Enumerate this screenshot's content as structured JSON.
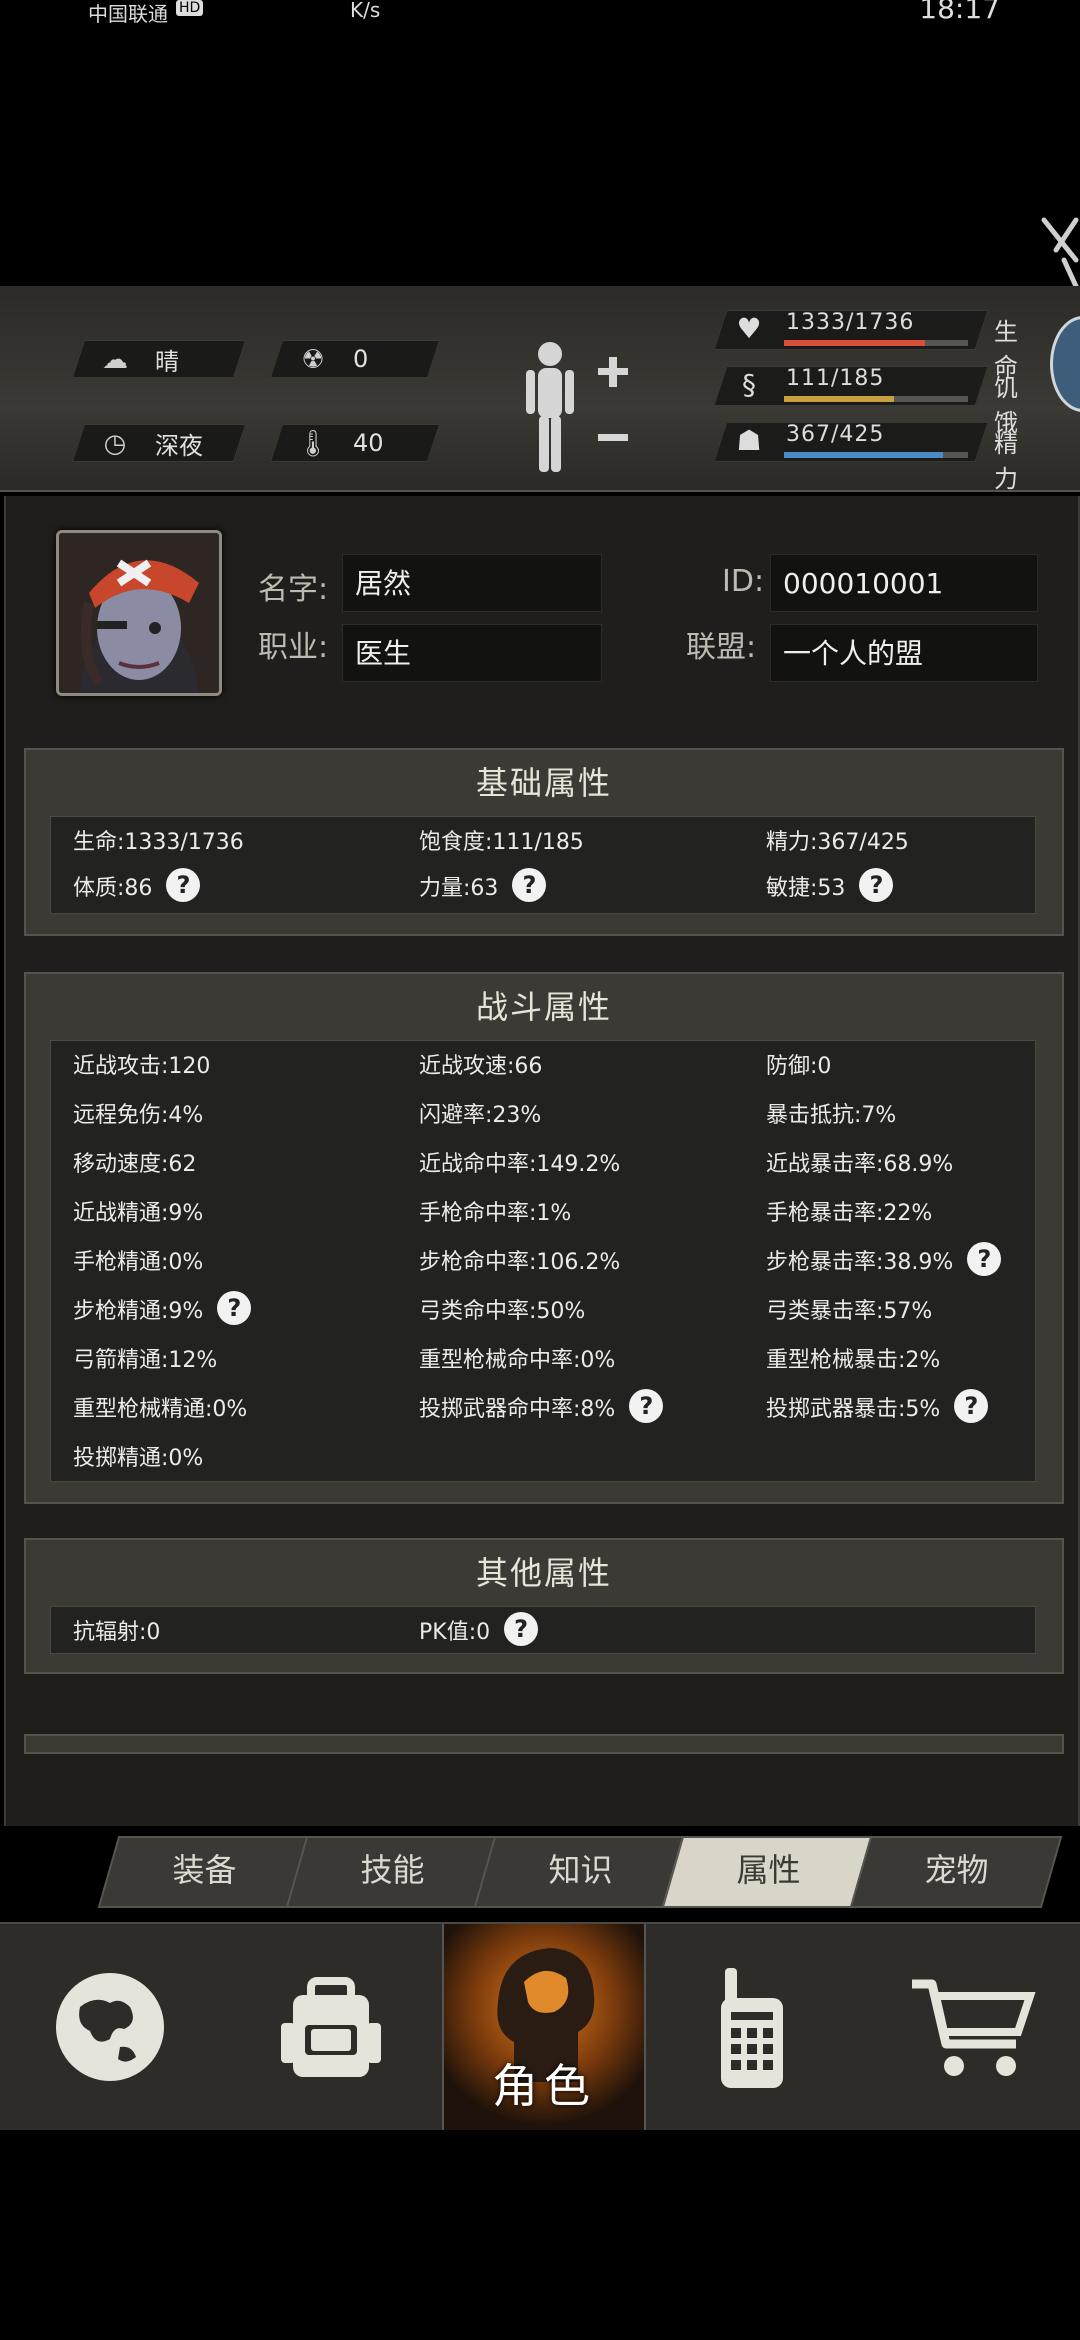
{
  "status_bar": {
    "carrier": "中国联通",
    "hd": "HD",
    "speed": "K/s",
    "clock": "18:17"
  },
  "hud": {
    "weather": {
      "icon": "cloud-sun-icon",
      "label": "晴"
    },
    "radiation": {
      "icon": "radiation-icon",
      "value": "0"
    },
    "time_of_day": {
      "icon": "clock-icon",
      "label": "深夜"
    },
    "temperature": {
      "icon": "thermometer-icon",
      "value": "40"
    },
    "bars": [
      {
        "icon": "heart-icon",
        "value": "1333/1736",
        "label": "生命",
        "fraction": 0.768,
        "color": "#d8503c"
      },
      {
        "icon": "stomach-icon",
        "value": "111/185",
        "label": "饥饿",
        "fraction": 0.6,
        "color": "#c8a040"
      },
      {
        "icon": "brain-icon",
        "value": "367/425",
        "label": "精力",
        "fraction": 0.864,
        "color": "#4a8ac8"
      }
    ]
  },
  "profile": {
    "name_label": "名字:",
    "name": "居然",
    "job_label": "职业:",
    "job": "医生",
    "id_label": "ID:",
    "id": "000010001",
    "alliance_label": "联盟:",
    "alliance": "一个人的盟"
  },
  "basic": {
    "title": "基础属性",
    "rows": [
      [
        "生命:1333/1736",
        "饱食度:111/185",
        "精力:367/425"
      ],
      [
        "体质:86",
        "力量:63",
        "敏捷:53"
      ]
    ]
  },
  "combat": {
    "title": "战斗属性",
    "rows": [
      [
        "近战攻击:120",
        "近战攻速:66",
        "防御:0"
      ],
      [
        "远程免伤:4%",
        "闪避率:23%",
        "暴击抵抗:7%"
      ],
      [
        "移动速度:62",
        "近战命中率:149.2%",
        "近战暴击率:68.9%"
      ],
      [
        "近战精通:9%",
        "手枪命中率:1%",
        "手枪暴击率:22%"
      ],
      [
        "手枪精通:0%",
        "步枪命中率:106.2%",
        "步枪暴击率:38.9%"
      ],
      [
        "步枪精通:9%",
        "弓类命中率:50%",
        "弓类暴击率:57%"
      ],
      [
        "弓箭精通:12%",
        "重型枪械命中率:0%",
        "重型枪械暴击:2%"
      ],
      [
        "重型枪械精通:0%",
        "投掷武器命中率:8%",
        "投掷武器暴击:5%"
      ],
      [
        "投掷精通:0%",
        "",
        ""
      ]
    ]
  },
  "other": {
    "title": "其他属性",
    "rows": [
      [
        "抗辐射:0",
        "PK值:0",
        ""
      ]
    ]
  },
  "help_glyph": "?",
  "tabs": [
    "装备",
    "技能",
    "知识",
    "属性",
    "宠物"
  ],
  "active_tab": 3,
  "nav": {
    "items": [
      "globe-icon",
      "backpack-icon",
      "character-icon",
      "radio-icon",
      "cart-icon"
    ],
    "active_label": "角色"
  }
}
